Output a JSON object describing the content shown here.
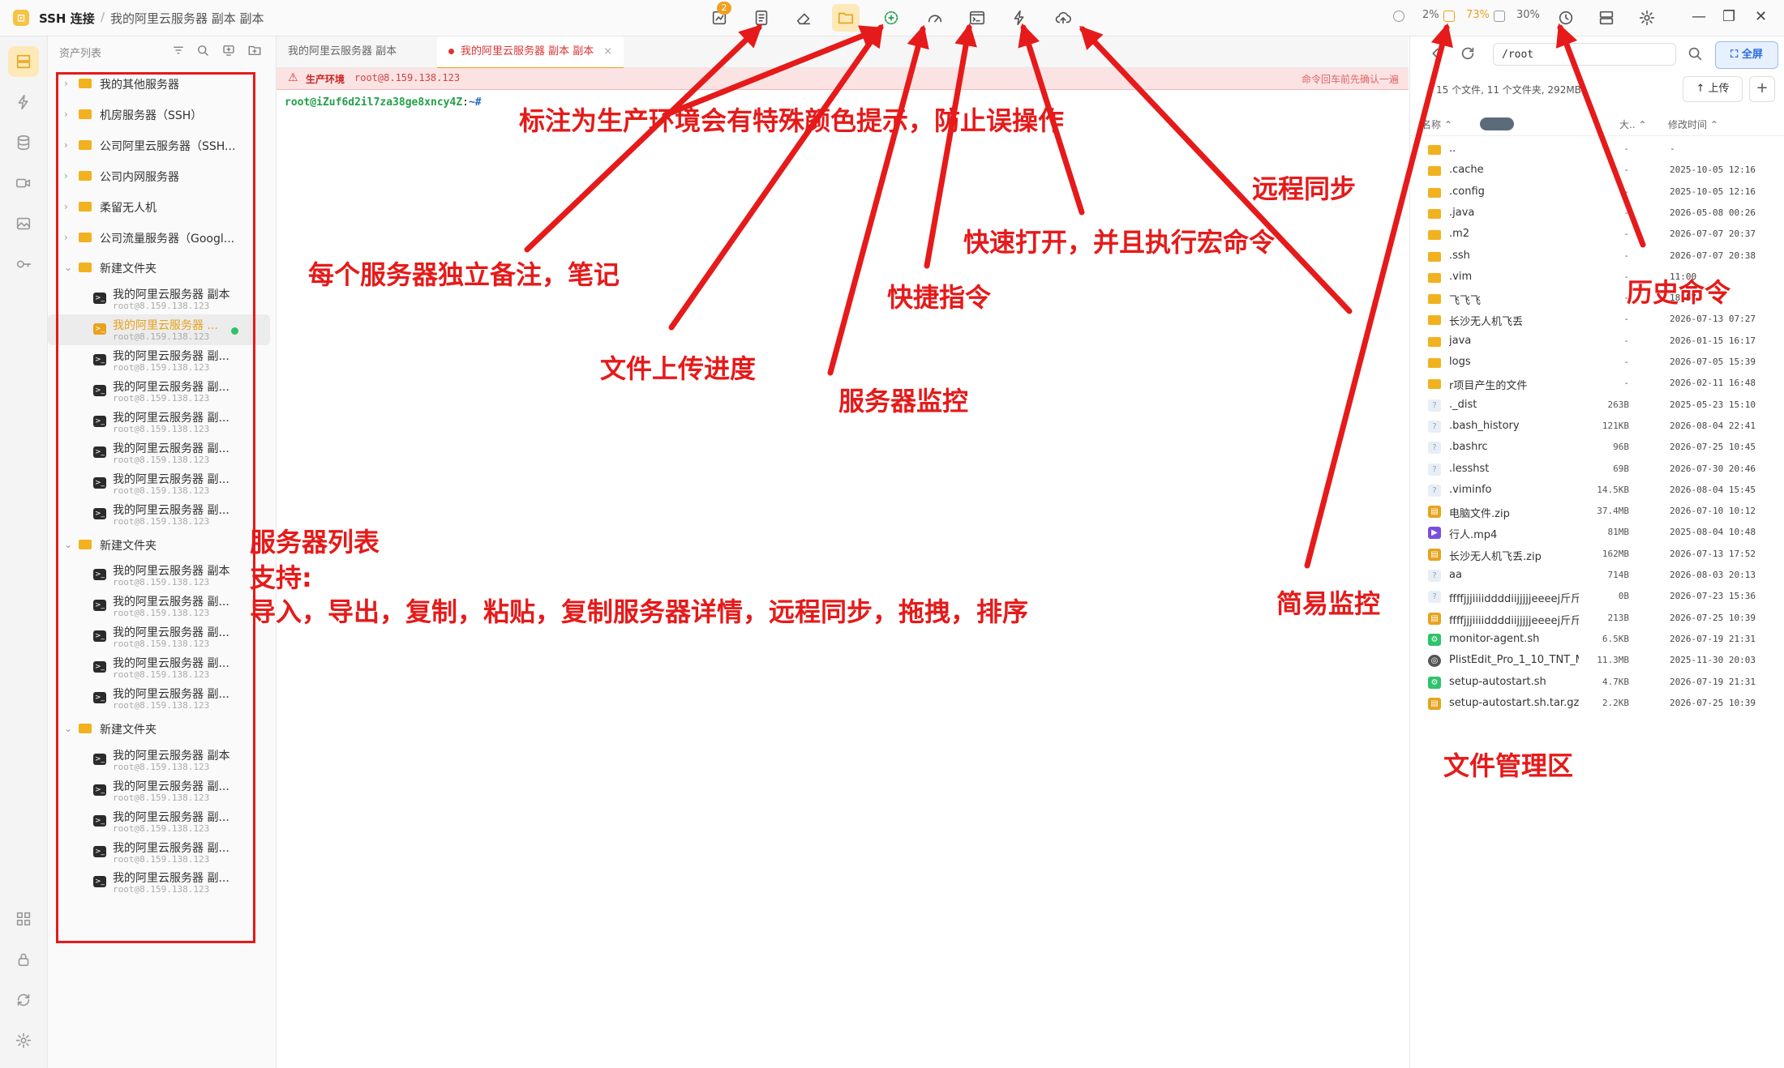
{
  "titlebar": {
    "app_title": "SSH 连接",
    "separator": "/",
    "breadcrumb": "我的阿里云服务器 副本 副本",
    "notification_count": "2",
    "stats": [
      {
        "label": "2%",
        "warn": false
      },
      {
        "label": "73%",
        "warn": true
      },
      {
        "label": "30%",
        "warn": false
      }
    ],
    "window_controls": [
      "—",
      "❐",
      "✕"
    ]
  },
  "asset_panel": {
    "header": "资产列表",
    "tree": [
      {
        "type": "folder",
        "label": "我的其他服务器",
        "expanded": false
      },
      {
        "type": "folder",
        "label": "机房服务器（SSH）",
        "expanded": false
      },
      {
        "type": "folder",
        "label": "公司阿里云服务器（SSH...",
        "expanded": false
      },
      {
        "type": "folder",
        "label": "公司内网服务器",
        "expanded": false
      },
      {
        "type": "folder",
        "label": "柔留无人机",
        "expanded": false
      },
      {
        "type": "folder",
        "label": "公司流量服务器（Googl...",
        "expanded": false
      },
      {
        "type": "folder",
        "label": "新建文件夹",
        "expanded": true
      },
      {
        "type": "server",
        "name": "我的阿里云服务器 副本",
        "addr": "root@8.159.138.123"
      },
      {
        "type": "server",
        "name": "我的阿里云服务器 ...",
        "addr": "root@8.159.138.123",
        "selected": true
      },
      {
        "type": "server",
        "name": "我的阿里云服务器 副...",
        "addr": "root@8.159.138.123"
      },
      {
        "type": "server",
        "name": "我的阿里云服务器 副...",
        "addr": "root@8.159.138.123"
      },
      {
        "type": "server",
        "name": "我的阿里云服务器 副...",
        "addr": "root@8.159.138.123"
      },
      {
        "type": "server",
        "name": "我的阿里云服务器 副...",
        "addr": "root@8.159.138.123"
      },
      {
        "type": "server",
        "name": "我的阿里云服务器 副...",
        "addr": "root@8.159.138.123"
      },
      {
        "type": "server",
        "name": "我的阿里云服务器 副...",
        "addr": "root@8.159.138.123"
      },
      {
        "type": "folder",
        "label": "新建文件夹",
        "expanded": true
      },
      {
        "type": "server",
        "name": "我的阿里云服务器 副本",
        "addr": "root@8.159.138.123"
      },
      {
        "type": "server",
        "name": "我的阿里云服务器 副...",
        "addr": "root@8.159.138.123"
      },
      {
        "type": "server",
        "name": "我的阿里云服务器 副...",
        "addr": "root@8.159.138.123"
      },
      {
        "type": "server",
        "name": "我的阿里云服务器 副...",
        "addr": "root@8.159.138.123"
      },
      {
        "type": "server",
        "name": "我的阿里云服务器 副...",
        "addr": "root@8.159.138.123"
      },
      {
        "type": "folder",
        "label": "新建文件夹",
        "expanded": true
      },
      {
        "type": "server",
        "name": "我的阿里云服务器 副本",
        "addr": "root@8.159.138.123"
      },
      {
        "type": "server",
        "name": "我的阿里云服务器 副...",
        "addr": "root@8.159.138.123"
      },
      {
        "type": "server",
        "name": "我的阿里云服务器 副...",
        "addr": "root@8.159.138.123"
      },
      {
        "type": "server",
        "name": "我的阿里云服务器 副...",
        "addr": "root@8.159.138.123"
      },
      {
        "type": "server",
        "name": "我的阿里云服务器 副...",
        "addr": "root@8.159.138.123"
      }
    ]
  },
  "tabs": [
    {
      "label": "我的阿里云服务器 副本",
      "active": false
    },
    {
      "label": "我的阿里云服务器 副本 副本",
      "active": true,
      "close": "×"
    }
  ],
  "production_banner": {
    "icon": "warning-icon",
    "label": "生产环境",
    "addr": "root@8.159.138.123",
    "hint": "命令回车前先确认一遍"
  },
  "terminal": {
    "prompt_user": "root@iZuf6d2il7za38ge8xncy4Z",
    "prompt_sep": ":",
    "prompt_path": "~#"
  },
  "file_manager": {
    "path": "/root",
    "fullscreen_label": "全屏",
    "summary": "15 个文件, 11 个文件夹, 292MB",
    "upload_label": "上传",
    "add_label": "+",
    "columns": {
      "name": "名称 ⌃",
      "size": "大.. ⌃",
      "time": "修改时间 ⌃"
    },
    "files": [
      {
        "name": "..",
        "size": "-",
        "time": "-",
        "icon": "folder"
      },
      {
        "name": ".cache",
        "size": "-",
        "time": "2025-10-05 12:16",
        "icon": "folder"
      },
      {
        "name": ".config",
        "size": "-",
        "time": "2025-10-05 12:16",
        "icon": "folder"
      },
      {
        "name": ".java",
        "size": "-",
        "time": "2026-05-08 00:26",
        "icon": "folder"
      },
      {
        "name": ".m2",
        "size": "-",
        "time": "2026-07-07 20:37",
        "icon": "folder"
      },
      {
        "name": ".ssh",
        "size": "-",
        "time": "2026-07-07 20:38",
        "icon": "folder"
      },
      {
        "name": ".vim",
        "size": "-",
        "time": "11:00",
        "icon": "folder"
      },
      {
        "name": "飞飞飞",
        "size": "-",
        "time": "18:57",
        "icon": "folder"
      },
      {
        "name": "长沙无人机飞丢",
        "size": "-",
        "time": "2026-07-13 07:27",
        "icon": "folder"
      },
      {
        "name": "java",
        "size": "-",
        "time": "2026-01-15 16:17",
        "icon": "folder"
      },
      {
        "name": "logs",
        "size": "-",
        "time": "2026-07-05 15:39",
        "icon": "folder"
      },
      {
        "name": "r项目产生的文件",
        "size": "-",
        "time": "2026-02-11 16:48",
        "icon": "folder"
      },
      {
        "name": "._dist",
        "size": "263B",
        "time": "2025-05-23 15:10",
        "icon": "unknown"
      },
      {
        "name": ".bash_history",
        "size": "121KB",
        "time": "2026-08-04 22:41",
        "icon": "unknown"
      },
      {
        "name": ".bashrc",
        "size": "96B",
        "time": "2026-07-25 10:45",
        "icon": "unknown"
      },
      {
        "name": ".lesshst",
        "size": "69B",
        "time": "2026-07-30 20:46",
        "icon": "unknown"
      },
      {
        "name": ".viminfo",
        "size": "14.5KB",
        "time": "2026-08-04 15:45",
        "icon": "unknown"
      },
      {
        "name": "电脑文件.zip",
        "size": "37.4MB",
        "time": "2026-07-10 10:12",
        "icon": "zip"
      },
      {
        "name": "行人.mp4",
        "size": "81MB",
        "time": "2025-08-04 10:48",
        "icon": "video"
      },
      {
        "name": "长沙无人机飞丢.zip",
        "size": "162MB",
        "time": "2026-07-13 17:52",
        "icon": "zip"
      },
      {
        "name": "aa",
        "size": "714B",
        "time": "2026-08-03 20:13",
        "icon": "unknown"
      },
      {
        "name": "ffffjjjiiiiddddiijjjjjeeeej斤斤计",
        "size": "0B",
        "time": "2026-07-23 15:36",
        "icon": "unknown"
      },
      {
        "name": "ffffjjjiiiiddddiijjjjjeeeej斤斤计",
        "size": "213B",
        "time": "2026-07-25 10:39",
        "icon": "zip"
      },
      {
        "name": "monitor-agent.sh",
        "size": "6.5KB",
        "time": "2026-07-19 21:31",
        "icon": "script"
      },
      {
        "name": "PlistEdit_Pro_1_10_TNT_M",
        "size": "11.3MB",
        "time": "2025-11-30 20:03",
        "icon": "app"
      },
      {
        "name": "setup-autostart.sh",
        "size": "4.7KB",
        "time": "2026-07-19 21:31",
        "icon": "script"
      },
      {
        "name": "setup-autostart.sh.tar.gz",
        "size": "2.2KB",
        "time": "2026-07-25 10:39",
        "icon": "zip"
      }
    ]
  },
  "annotations": {
    "production": "标注为生产环境会有特殊颜色提示，防止误操作",
    "notes": "每个服务器独立备注，笔记",
    "upload_progress": "文件上传进度",
    "quick_cmd": "快捷指令",
    "monitor": "服务器监控",
    "macro": "快速打开，并且执行宏命令",
    "remote_sync": "远程同步",
    "history": "历史命令",
    "simple_monitor": "简易监控",
    "file_area": "文件管理区",
    "server_list_1": "服务器列表",
    "server_list_2": "支持:",
    "server_list_3": "导入，导出，复制，粘贴，复制服务器详情，远程同步，拖拽，排序"
  },
  "colors": {
    "accent": "#e8a21c",
    "annotation": "#e61a1a",
    "production": "#d33"
  }
}
